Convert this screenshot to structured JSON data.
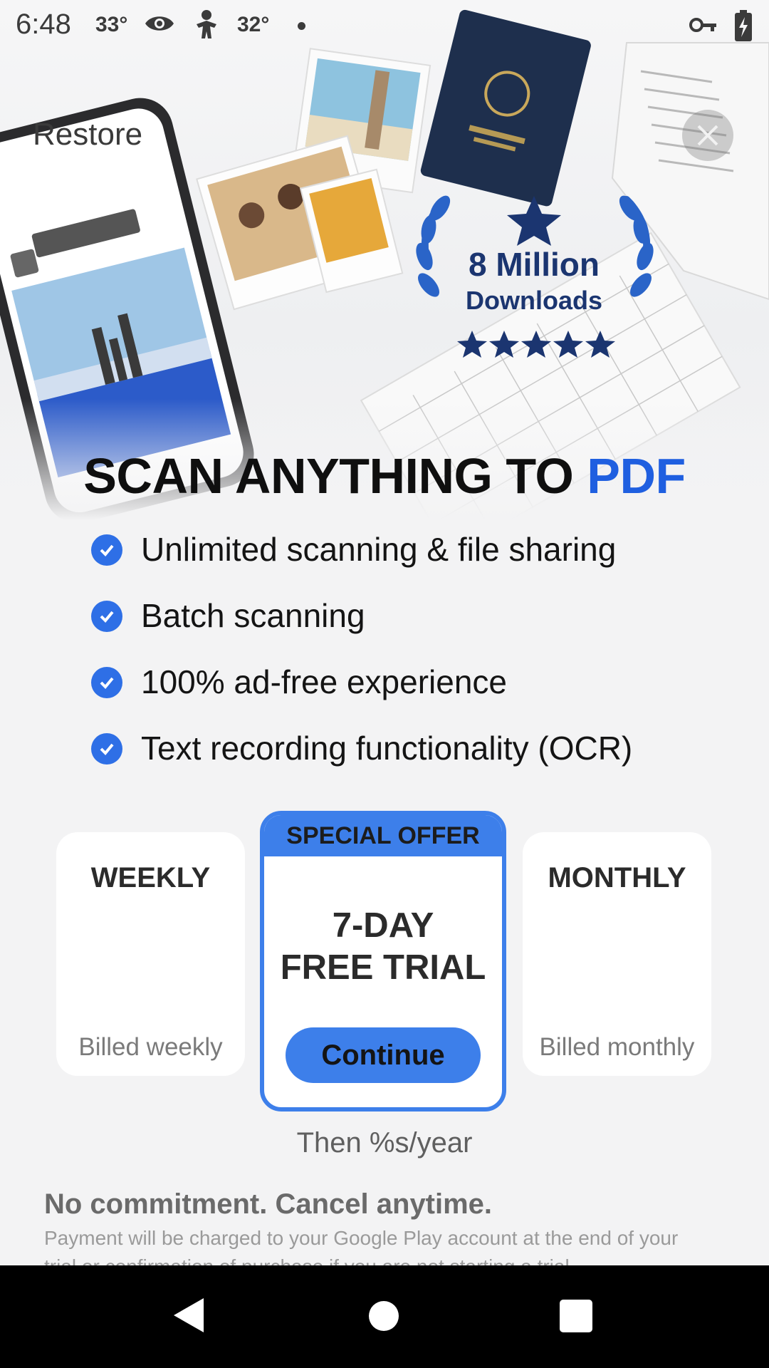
{
  "status_bar": {
    "time": "6:48",
    "temp1": "33°",
    "temp2": "32°",
    "icons": [
      "eye-icon",
      "person-icon",
      "dot-icon",
      "vpn-key-icon",
      "battery-charging-icon"
    ]
  },
  "header": {
    "restore_label": "Restore",
    "close_icon": "close-icon"
  },
  "hero": {
    "badge_line1": "8 Million",
    "badge_line2": "Downloads",
    "badge_stars": 5
  },
  "title": {
    "main": "SCAN ANYTHING TO ",
    "accent": "PDF",
    "accent_color": "#1f5fe0"
  },
  "features": [
    {
      "label": "Unlimited scanning & file sharing"
    },
    {
      "label": "Batch scanning"
    },
    {
      "label": "100% ad-free experience"
    },
    {
      "label": "Text recording functionality (OCR)"
    }
  ],
  "plans": {
    "weekly": {
      "name": "WEEKLY",
      "billed": "Billed weekly"
    },
    "offer": {
      "badge": "SPECIAL OFFER",
      "line1": "7-DAY",
      "line2": "FREE TRIAL",
      "button": "Continue"
    },
    "monthly": {
      "name": "MONTHLY",
      "billed": "Billed monthly"
    },
    "accent_color": "#3d7fea"
  },
  "footer": {
    "then_price": "Then %s/year",
    "no_commitment": "No commitment. Cancel anytime.",
    "legal": "Payment will be charged to your Google Play account at the end of your trial or confirmation of purchase if you are not starting a trial."
  },
  "nav": {
    "icons": [
      "back-icon",
      "home-icon",
      "recents-icon"
    ]
  }
}
